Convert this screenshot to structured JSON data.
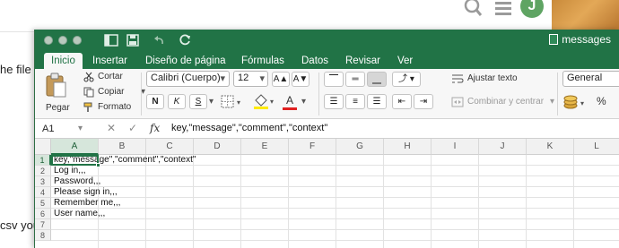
{
  "background": {
    "fragment_left": "he file p",
    "fragment_bottom": "csv you",
    "avatar_letter": "J",
    "icons": [
      "search-icon",
      "menu-icon"
    ]
  },
  "window": {
    "title": "messages",
    "title_icons": [
      "sidebar-icon",
      "save-icon",
      "undo-icon",
      "redo-icon"
    ]
  },
  "tabs": [
    "Inicio",
    "Insertar",
    "Diseño de página",
    "Fórmulas",
    "Datos",
    "Revisar",
    "Ver"
  ],
  "ribbon": {
    "paste": "Pegar",
    "cut": "Cortar",
    "copy": "Copiar",
    "format": "Formato",
    "font_name": "Calibri (Cuerpo)",
    "font_size": "12",
    "grow": "A▲",
    "shrink": "A▼",
    "bold": "N",
    "italic": "K",
    "underline": "S",
    "font_color_letter": "A",
    "wrap_text": "Ajustar texto",
    "merge_center": "Combinar y centrar",
    "number_format": "General",
    "percent": "%"
  },
  "formula_bar": {
    "name_box": "A1",
    "fx": "fx",
    "content": "key,\"message\",\"comment\",\"context\""
  },
  "sheet": {
    "columns": [
      "A",
      "B",
      "C",
      "D",
      "E",
      "F",
      "G",
      "H",
      "I",
      "J",
      "K",
      "L"
    ],
    "rows": [
      "1",
      "2",
      "3",
      "4",
      "5",
      "6",
      "7",
      "8"
    ],
    "cells": [
      "key,\"message\",\"comment\",\"context\"",
      "Log in,,,",
      "Password,,,",
      "Please sign in,,,",
      "Remember me,,,",
      "User name,,,"
    ]
  },
  "colors": {
    "excel_green": "#217346",
    "selection": "#217346",
    "font_color_bar": "#e02020",
    "fill_color_bar": "#ffeb00"
  }
}
